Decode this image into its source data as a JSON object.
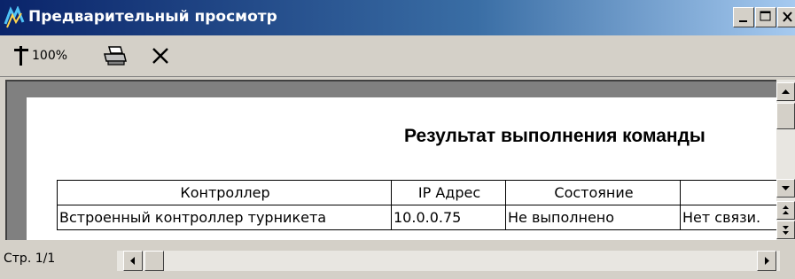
{
  "window": {
    "title": "Предварительный просмотр",
    "title_color": "#0a246a"
  },
  "toolbar": {
    "zoom_label": "100%",
    "tools": [
      "zoom-icon",
      "print-icon",
      "close-preview-icon"
    ]
  },
  "report": {
    "title": "Результат выполнения команды",
    "columns": [
      "Контроллер",
      "IP Адрес",
      "Состояние",
      ""
    ],
    "rows": [
      [
        "Встроенный контроллер турникета",
        "10.0.0.75",
        "Не выполнено",
        "Нет связи."
      ]
    ]
  },
  "status": {
    "page_label": "Стр. 1/1"
  }
}
